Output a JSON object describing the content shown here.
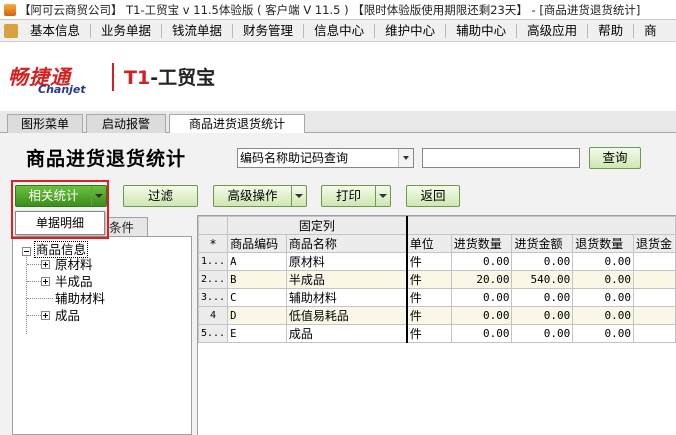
{
  "window": {
    "title": "【阿可云商贸公司】 T1-工贸宝 v 11.5体验版 ( 客户端 V 11.5 ) 【限时体验版使用期限还剩23天】 - [商品进货退货统计]"
  },
  "menu": [
    "基本信息",
    "业务单据",
    "钱流单据",
    "财务管理",
    "信息中心",
    "维护中心",
    "辅助中心",
    "高级应用",
    "帮助",
    "商"
  ],
  "logo": {
    "cn": "畅捷通",
    "en": "Chanjet",
    "product_prefix": "T1",
    "product_suffix": "-工贸宝"
  },
  "tabs": [
    "图形菜单",
    "启动报警",
    "商品进货退货统计"
  ],
  "page": {
    "heading": "商品进货退货统计",
    "search_mode": "编码名称助记码查询",
    "search_value": "",
    "query_button": "查询"
  },
  "toolbar": {
    "stats_button": "相关统计",
    "filter_button": "过滤",
    "advanced_button": "高级操作",
    "print_button": "打印",
    "back_button": "返回"
  },
  "stats_dropdown": {
    "items": [
      "单据明细"
    ]
  },
  "left_panel": {
    "tab_label": "条件",
    "tree": {
      "root": "商品信息",
      "children": [
        "原材料",
        "半成品",
        "辅助材料",
        "成品"
      ]
    }
  },
  "grid": {
    "group_header": "固定列",
    "star": "*",
    "columns": [
      "商品编码",
      "商品名称",
      "单位",
      "进货数量",
      "进货金额",
      "退货数量",
      "退货金"
    ],
    "rows": [
      {
        "index": "1...",
        "code": "A",
        "name": "原材料",
        "unit": "件",
        "in_qty": "0.00",
        "in_amt": "0.00",
        "ret_qty": "0.00"
      },
      {
        "index": "2...",
        "code": "B",
        "name": "半成品",
        "unit": "件",
        "in_qty": "20.00",
        "in_amt": "540.00",
        "ret_qty": "0.00"
      },
      {
        "index": "3...",
        "code": "C",
        "name": "辅助材料",
        "unit": "件",
        "in_qty": "0.00",
        "in_amt": "0.00",
        "ret_qty": "0.00"
      },
      {
        "index": "4",
        "code": "D",
        "name": "低值易耗品",
        "unit": "件",
        "in_qty": "0.00",
        "in_amt": "0.00",
        "ret_qty": "0.00"
      },
      {
        "index": "5...",
        "code": "E",
        "name": "成品",
        "unit": "件",
        "in_qty": "0.00",
        "in_amt": "0.00",
        "ret_qty": "0.00"
      }
    ]
  }
}
